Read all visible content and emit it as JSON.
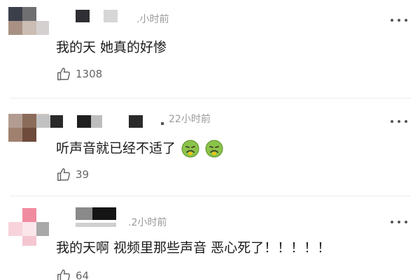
{
  "comments": [
    {
      "time": ".小时前",
      "text": "我的天 她真的好惨",
      "likes": "1308",
      "emojis": []
    },
    {
      "time": "22小时前",
      "text": "听声音就已经不适了",
      "likes": "39",
      "emojis": [
        "nauseated-face",
        "nauseated-face"
      ]
    },
    {
      "time": ".2小时前",
      "text": "我的天啊 视频里那些声音  恶心死了！！！！！",
      "likes": "64",
      "emojis": []
    }
  ],
  "colors": {
    "text": "#1a1a1a",
    "meta": "#9a9a9a",
    "icon": "#666666",
    "divider": "#ececec"
  },
  "icons": {
    "more": "more-dots-icon",
    "like": "thumbs-up-icon"
  }
}
